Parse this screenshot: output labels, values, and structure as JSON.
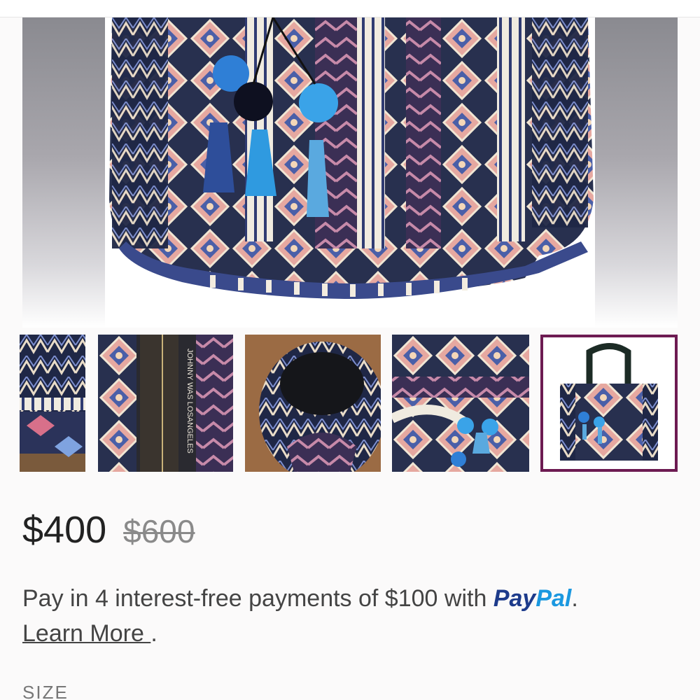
{
  "product": {
    "price": "$400",
    "original_price": "$600",
    "paypal": {
      "message": "Pay in 4 interest-free payments of $100 with",
      "brand_part1": "Pay",
      "brand_part2": "Pal",
      "period": ".",
      "learn_more": "Learn More ",
      "learn_more_after": "."
    },
    "size_label": "SIZE"
  },
  "gallery": {
    "selected_index": 4,
    "thumbnails": [
      {
        "name": "thumbnail-strap-detail"
      },
      {
        "name": "thumbnail-brand-label",
        "label_text": "JOHNNY WAS LOSANGELES"
      },
      {
        "name": "thumbnail-bag-interior"
      },
      {
        "name": "thumbnail-pattern-tassels"
      },
      {
        "name": "thumbnail-full-bag"
      }
    ]
  },
  "colors": {
    "accent_selected": "#6d1b52",
    "paypal_dark": "#1d3b8b",
    "paypal_light": "#1b98e0"
  }
}
